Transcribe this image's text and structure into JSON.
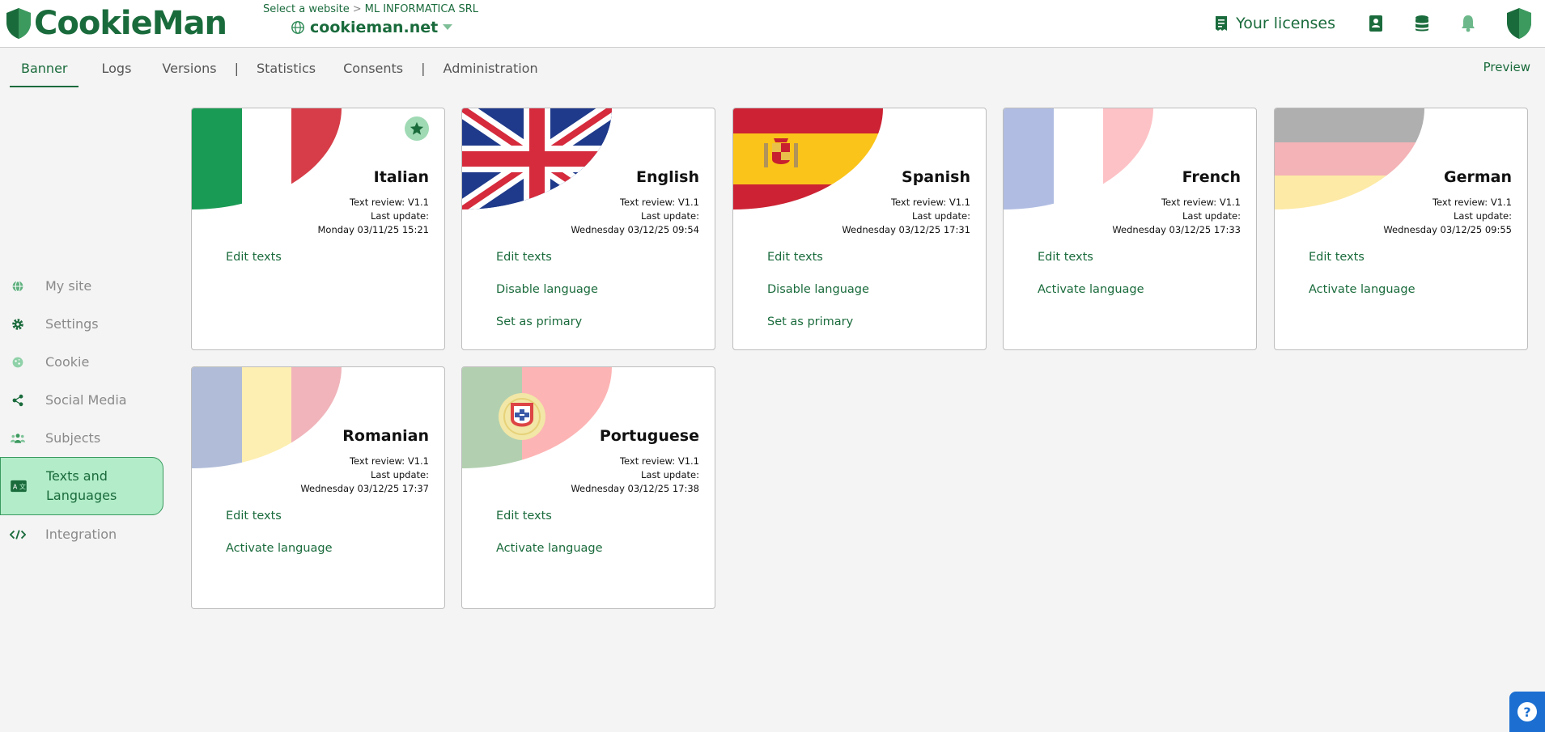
{
  "app": {
    "logo_text": "CookieMan"
  },
  "site_selector": {
    "prompt": "Select a website",
    "company": "ML INFORMATICA SRL",
    "site": "cookieman.net"
  },
  "header": {
    "licenses_label": "Your licenses"
  },
  "tabs": [
    {
      "label": "Banner"
    },
    {
      "label": "Logs"
    },
    {
      "label": "Versions"
    },
    {
      "label": "Statistics"
    },
    {
      "label": "Consents"
    },
    {
      "label": "Administration"
    }
  ],
  "tab_separator": "|",
  "preview_label": "Preview",
  "sidebar": {
    "items": [
      {
        "label": "My site",
        "icon": "globe-icon"
      },
      {
        "label": "Settings",
        "icon": "gear-icon"
      },
      {
        "label": "Cookie",
        "icon": "cookie-icon"
      },
      {
        "label": "Social Media",
        "icon": "share-icon"
      },
      {
        "label": "Subjects",
        "icon": "users-icon"
      },
      {
        "label": "Texts and Languages",
        "icon": "translate-icon"
      },
      {
        "label": "Integration",
        "icon": "code-icon"
      }
    ]
  },
  "languages": [
    {
      "name": "Italian",
      "review": "Text review: V1.1",
      "update_label": "Last update:",
      "update": "Monday 03/11/25 15:21",
      "actions": [
        "Edit texts"
      ]
    },
    {
      "name": "English",
      "review": "Text review: V1.1",
      "update_label": "Last update:",
      "update": "Wednesday 03/12/25 09:54",
      "actions": [
        "Edit texts",
        "Disable language",
        "Set as primary"
      ]
    },
    {
      "name": "Spanish",
      "review": "Text review: V1.1",
      "update_label": "Last update:",
      "update": "Wednesday 03/12/25 17:31",
      "actions": [
        "Edit texts",
        "Disable language",
        "Set as primary"
      ]
    },
    {
      "name": "French",
      "review": "Text review: V1.1",
      "update_label": "Last update:",
      "update": "Wednesday 03/12/25 17:33",
      "actions": [
        "Edit texts",
        "Activate language"
      ]
    },
    {
      "name": "German",
      "review": "Text review: V1.1",
      "update_label": "Last update:",
      "update": "Wednesday 03/12/25 09:55",
      "actions": [
        "Edit texts",
        "Activate language"
      ]
    },
    {
      "name": "Romanian",
      "review": "Text review: V1.1",
      "update_label": "Last update:",
      "update": "Wednesday 03/12/25 17:37",
      "actions": [
        "Edit texts",
        "Activate language"
      ]
    },
    {
      "name": "Portuguese",
      "review": "Text review: V1.1",
      "update_label": "Last update:",
      "update": "Wednesday 03/12/25 17:38",
      "actions": [
        "Edit texts",
        "Activate language"
      ]
    }
  ],
  "help_label": "?",
  "colors": {
    "brand": "#1a6b3c",
    "accent_light": "#b2ecc8",
    "help": "#1c6fd1"
  }
}
